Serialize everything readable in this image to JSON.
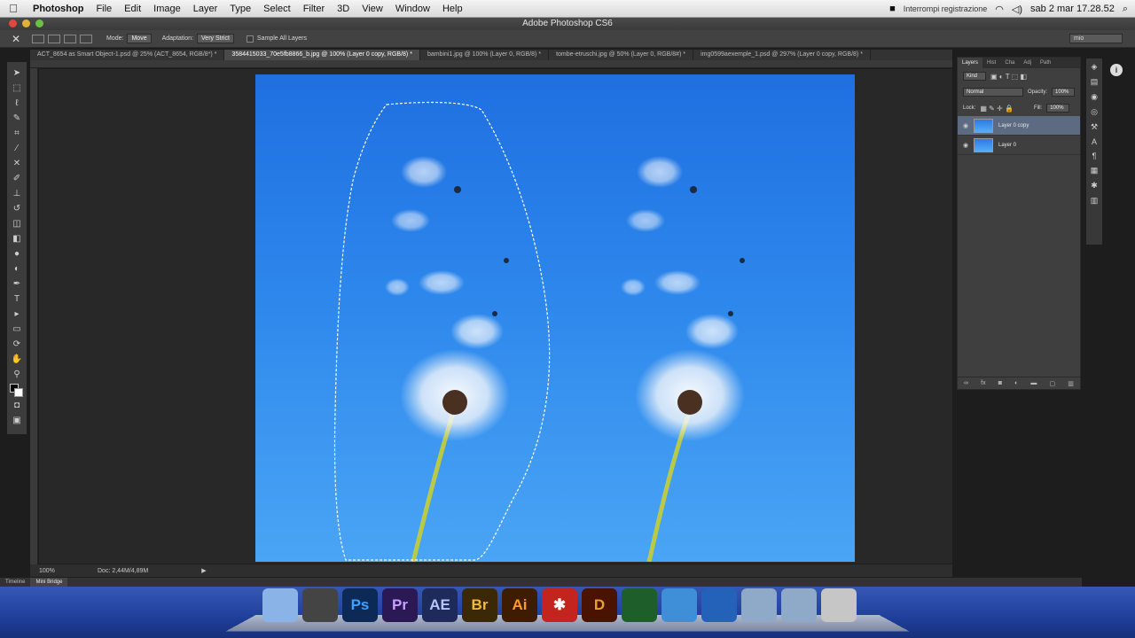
{
  "menubar": {
    "apple": "",
    "items": [
      "Photoshop",
      "File",
      "Edit",
      "Image",
      "Layer",
      "Type",
      "Select",
      "Filter",
      "3D",
      "View",
      "Window",
      "Help"
    ],
    "recording": "Interrompi registrazione",
    "datetime": "sab 2 mar  17.28.52"
  },
  "titlebar": {
    "title": "Adobe Photoshop CS6"
  },
  "options": {
    "mode_label": "Mode:",
    "mode_value": "Move",
    "adaptation_label": "Adaptation:",
    "adaptation_value": "Very Strict",
    "sample_label": "Sample All Layers",
    "workspace_value": "mio"
  },
  "tabs": [
    "ACT_8654 as Smart Object-1.psd @ 25% (ACT_8654, RGB/8*) *",
    "3584415033_70e5fb8866_b.jpg @ 100% (Layer 0 copy, RGB/8) *",
    "bambini1.jpg @ 100% (Layer 0, RGB/8) *",
    "tombe-etruschi.jpg @ 50% (Layer 0, RGB/8#) *",
    "img0599aexemple_1.psd @ 297% (Layer 0 copy, RGB/8) *"
  ],
  "status": {
    "zoom": "100%",
    "doc": "Doc: 2,44M/4,89M"
  },
  "bottom_tabs": [
    "Timeline",
    "Mini Bridge"
  ],
  "layers_panel": {
    "tabs": [
      "Layers",
      "Hist",
      "Cha",
      "Adj",
      "Path"
    ],
    "kind": "Kind",
    "blend": "Normal",
    "opacity_label": "Opacity:",
    "opacity_value": "100%",
    "lock_label": "Lock:",
    "fill_label": "Fill:",
    "fill_value": "100%",
    "layers": [
      {
        "name": "Layer 0 copy",
        "selected": true
      },
      {
        "name": "Layer 0",
        "selected": false
      }
    ]
  },
  "dock": [
    {
      "name": "Finder",
      "label": "",
      "color": "#8ab4e8"
    },
    {
      "name": "Disk Utility",
      "label": "",
      "color": "#444444"
    },
    {
      "name": "Photoshop",
      "label": "Ps",
      "color": "#0c2a55"
    },
    {
      "name": "Premiere",
      "label": "Pr",
      "color": "#2b1955"
    },
    {
      "name": "After Effects",
      "label": "AE",
      "color": "#1d2a5a"
    },
    {
      "name": "Bridge",
      "label": "Br",
      "color": "#3a2806"
    },
    {
      "name": "Illustrator",
      "label": "Ai",
      "color": "#3d1c02"
    },
    {
      "name": "App",
      "label": "✱",
      "color": "#c3241d"
    },
    {
      "name": "Diablo",
      "label": "D",
      "color": "#4a1200"
    },
    {
      "name": "Globe",
      "label": "",
      "color": "#1e5e2a"
    },
    {
      "name": "Safari",
      "label": "",
      "color": "#3f8fd8"
    },
    {
      "name": "QuickTime",
      "label": "",
      "color": "#2362b8"
    },
    {
      "name": "Applications",
      "label": "",
      "color": "#8fa9c9"
    },
    {
      "name": "Downloads",
      "label": "",
      "color": "#8fa9c9"
    },
    {
      "name": "Trash",
      "label": "",
      "color": "#c6c6c6"
    }
  ]
}
